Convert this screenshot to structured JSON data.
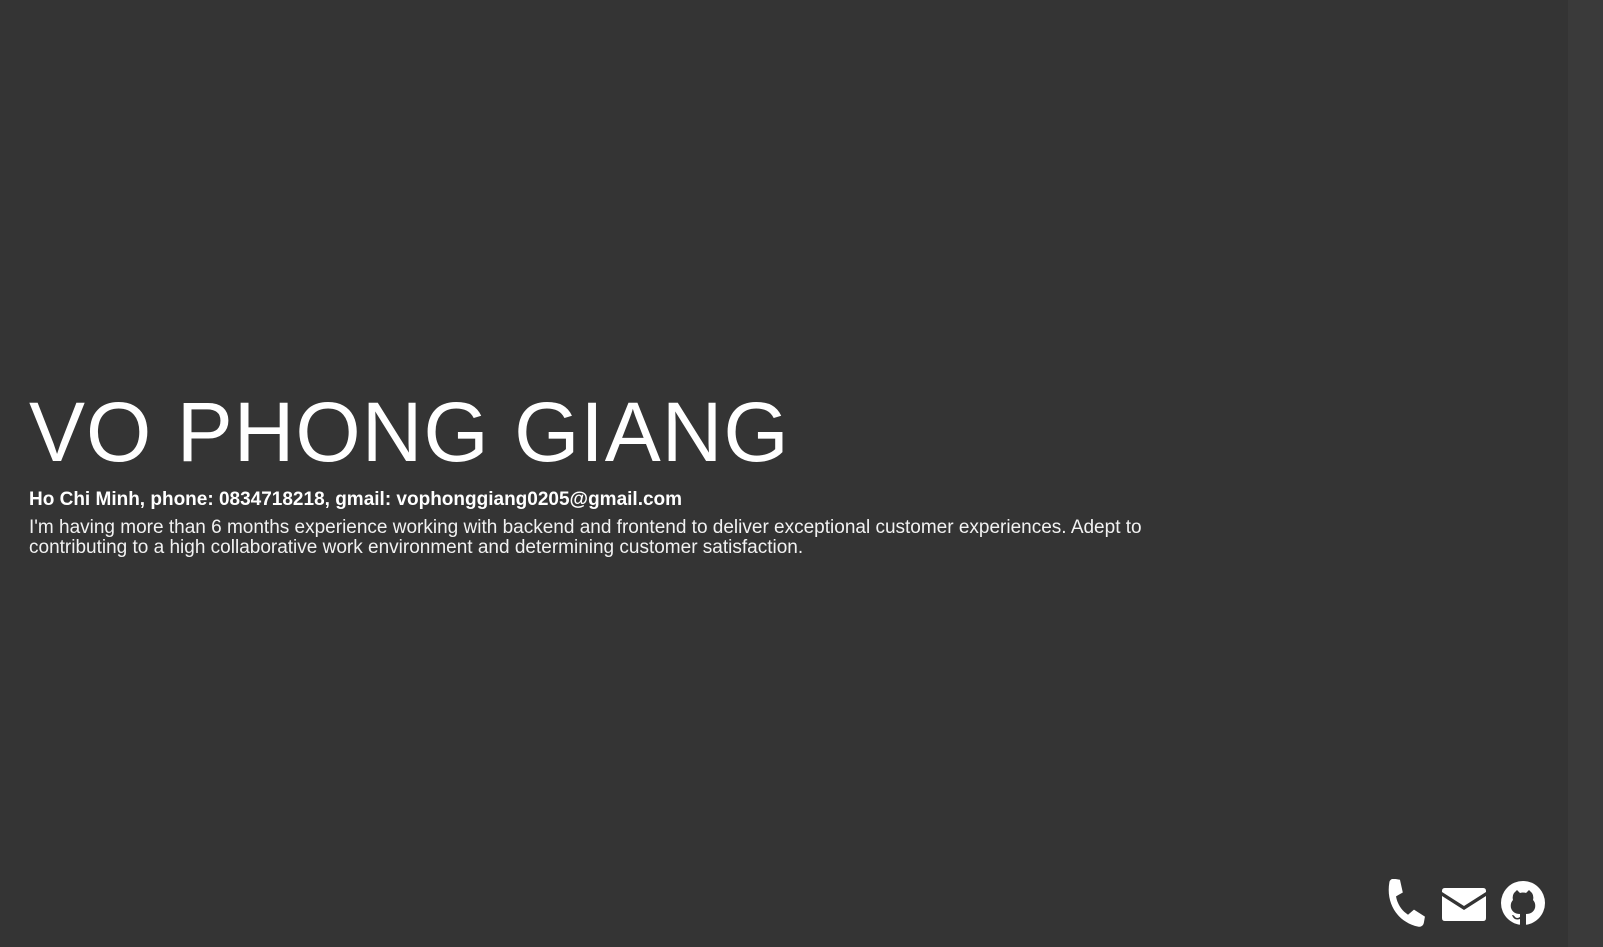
{
  "profile": {
    "name": "VO PHONG GIANG",
    "contact_line": "Ho Chi Minh, phone: 0834718218, gmail: vophonggiang0205@gmail.com",
    "bio": "I'm having more than 6 months experience working with backend and frontend to deliver exceptional customer experiences. Adept to contributing to a high collaborative work environment and determining customer satisfaction."
  },
  "social": [
    {
      "icon": "phone-icon"
    },
    {
      "icon": "envelope-icon"
    },
    {
      "icon": "github-icon"
    }
  ],
  "colors": {
    "background": "#343434",
    "text": "#ffffff"
  }
}
